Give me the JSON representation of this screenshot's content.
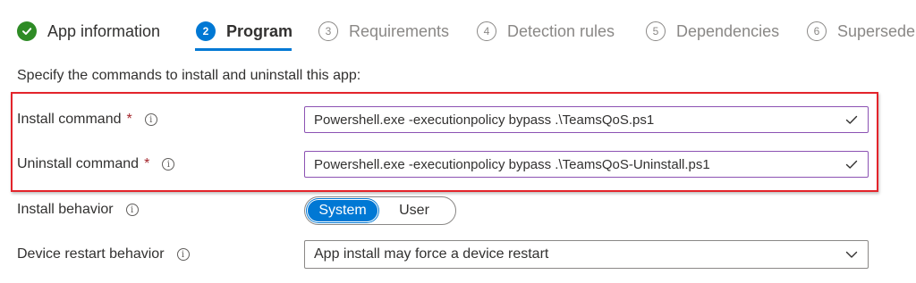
{
  "wizard": {
    "steps": [
      {
        "number": "",
        "label": "App information",
        "state": "done"
      },
      {
        "number": "2",
        "label": "Program",
        "state": "current"
      },
      {
        "number": "3",
        "label": "Requirements",
        "state": "pending"
      },
      {
        "number": "4",
        "label": "Detection rules",
        "state": "pending"
      },
      {
        "number": "5",
        "label": "Dependencies",
        "state": "pending"
      },
      {
        "number": "6",
        "label": "Supersedence",
        "state": "pending"
      }
    ]
  },
  "form": {
    "instructions": "Specify the commands to install and uninstall this app:",
    "install_command": {
      "label": "Install command",
      "required_mark": "*",
      "value": "Powershell.exe -executionpolicy bypass .\\TeamsQoS.ps1"
    },
    "uninstall_command": {
      "label": "Uninstall command",
      "required_mark": "*",
      "value": "Powershell.exe -executionpolicy bypass .\\TeamsQoS-Uninstall.ps1"
    },
    "install_behavior": {
      "label": "Install behavior",
      "options": [
        "System",
        "User"
      ],
      "selected": "System"
    },
    "device_restart_behavior": {
      "label": "Device restart behavior",
      "value": "App install may force a device restart"
    }
  },
  "colors": {
    "accent": "#0078d4",
    "done_green": "#2e8b25",
    "highlight_red": "#e3242b",
    "valid_input_border": "#8c52b3",
    "required": "#a4262c"
  },
  "icons": {
    "step_done": "checkmark-circle-icon",
    "info": "info-icon",
    "valid": "checkmark-icon",
    "dropdown": "chevron-down-icon"
  }
}
